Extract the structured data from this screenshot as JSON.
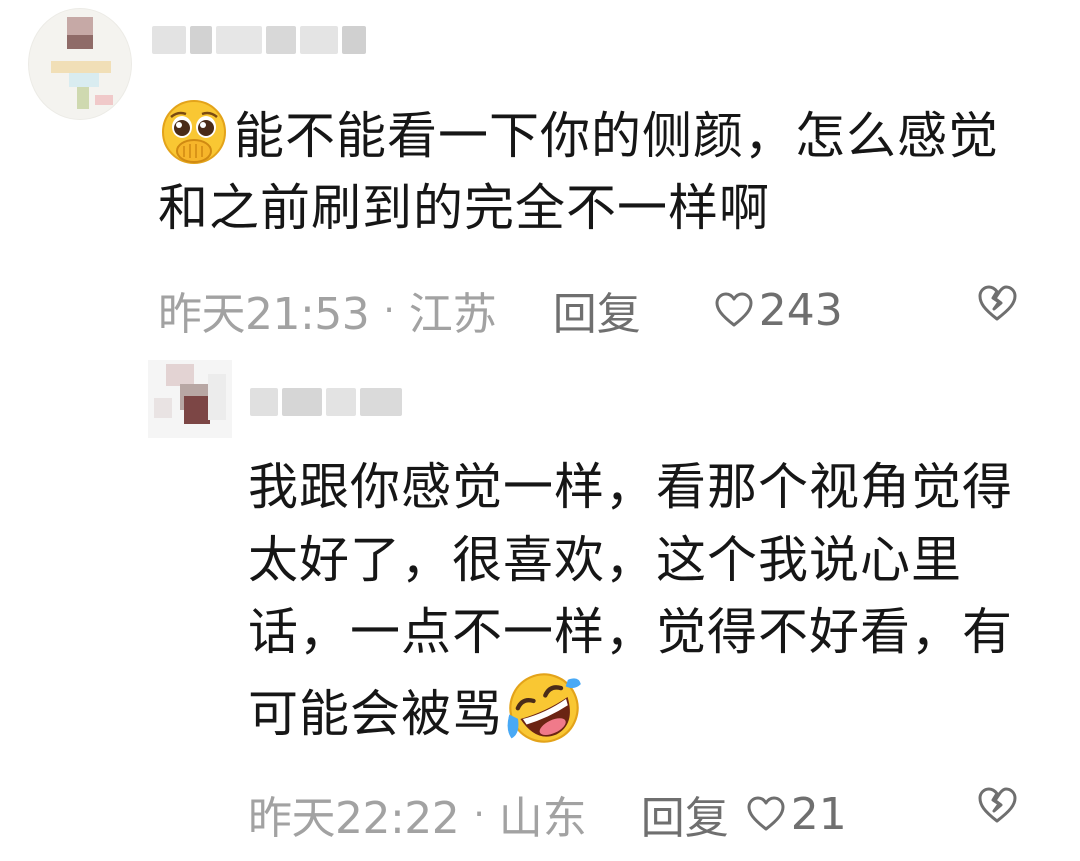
{
  "comment1": {
    "text": "能不能看一下你的侧颜，怎么感觉和之前刷到的完全不一样啊",
    "time": "昨天21:53",
    "separator": "·",
    "location": "江苏",
    "reply_label": "回复",
    "likes": "243",
    "emoji": "pleading-hand-over-mouth-emoji"
  },
  "comment2": {
    "text": "我跟你感觉一样，看那个视角觉得太好了，很喜欢，这个我说心里话，一点不一样，觉得不好看，有可能会被骂",
    "time": "昨天22:22",
    "separator": "·",
    "location": "山东",
    "reply_label": "回复",
    "likes": "21",
    "emoji": "rolling-laughing-emoji"
  },
  "icons": {
    "like": "heart-outline-icon",
    "dislike": "broken-heart-icon"
  },
  "colors": {
    "text": "#161616",
    "meta": "#a2a2a2",
    "action": "#6f6f6f"
  }
}
